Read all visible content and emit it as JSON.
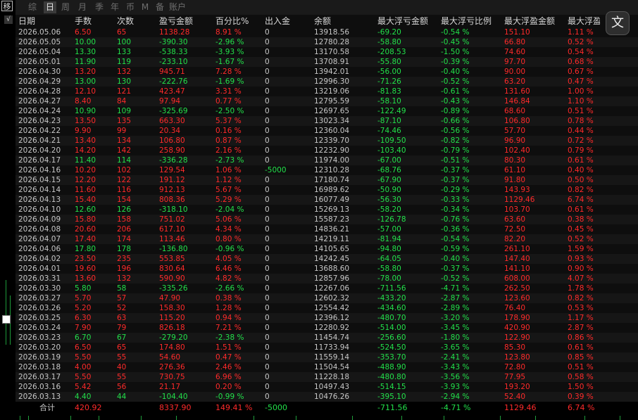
{
  "window": {
    "mode_icon_label": "移"
  },
  "tabs": [
    "综",
    "日",
    "周",
    "月",
    "季",
    "年",
    "币",
    "M",
    "备",
    "账户"
  ],
  "active_tab": 1,
  "headers": [
    "日期",
    "手数",
    "次数",
    "盈亏金额",
    "百分比%",
    "出入金",
    "余额",
    "最大浮亏金额",
    "最大浮亏比例",
    "最大浮盈金额",
    "最大浮盈比"
  ],
  "rows": [
    {
      "date": "2026.05.06",
      "lots": "6.50",
      "count": "65",
      "pnl": "1138.28",
      "pct": "8.91 %",
      "flow": "0",
      "balance": "13918.56",
      "dd_amt": "-69.20",
      "dd_pct": "-0.54 %",
      "fp_amt": "151.10",
      "fp_pct": "1.11 %",
      "sign": "up"
    },
    {
      "date": "2026.05.05",
      "lots": "10.00",
      "count": "100",
      "pnl": "-390.30",
      "pct": "-2.96 %",
      "flow": "0",
      "balance": "12780.28",
      "dd_amt": "-58.80",
      "dd_pct": "-0.45 %",
      "fp_amt": "66.80",
      "fp_pct": "0.52 %",
      "sign": "dn"
    },
    {
      "date": "2026.05.04",
      "lots": "13.30",
      "count": "133",
      "pnl": "-538.33",
      "pct": "-3.93 %",
      "flow": "0",
      "balance": "13170.58",
      "dd_amt": "-208.53",
      "dd_pct": "-1.50 %",
      "fp_amt": "74.60",
      "fp_pct": "0.54 %",
      "sign": "dn"
    },
    {
      "date": "2026.05.01",
      "lots": "11.90",
      "count": "119",
      "pnl": "-233.10",
      "pct": "-1.67 %",
      "flow": "0",
      "balance": "13708.91",
      "dd_amt": "-55.80",
      "dd_pct": "-0.39 %",
      "fp_amt": "97.70",
      "fp_pct": "0.68 %",
      "sign": "dn"
    },
    {
      "date": "2026.04.30",
      "lots": "13.20",
      "count": "132",
      "pnl": "945.71",
      "pct": "7.28 %",
      "flow": "0",
      "balance": "13942.01",
      "dd_amt": "-56.00",
      "dd_pct": "-0.40 %",
      "fp_amt": "90.00",
      "fp_pct": "0.67 %",
      "sign": "up"
    },
    {
      "date": "2026.04.29",
      "lots": "13.00",
      "count": "130",
      "pnl": "-222.76",
      "pct": "-1.69 %",
      "flow": "0",
      "balance": "12996.30",
      "dd_amt": "-71.26",
      "dd_pct": "-0.52 %",
      "fp_amt": "63.20",
      "fp_pct": "0.47 %",
      "sign": "dn"
    },
    {
      "date": "2026.04.28",
      "lots": "12.10",
      "count": "121",
      "pnl": "423.47",
      "pct": "3.31 %",
      "flow": "0",
      "balance": "13219.06",
      "dd_amt": "-81.83",
      "dd_pct": "-0.61 %",
      "fp_amt": "131.60",
      "fp_pct": "1.00 %",
      "sign": "up"
    },
    {
      "date": "2026.04.27",
      "lots": "8.40",
      "count": "84",
      "pnl": "97.94",
      "pct": "0.77 %",
      "flow": "0",
      "balance": "12795.59",
      "dd_amt": "-58.10",
      "dd_pct": "-0.43 %",
      "fp_amt": "146.84",
      "fp_pct": "1.10 %",
      "sign": "up"
    },
    {
      "date": "2026.04.24",
      "lots": "10.90",
      "count": "109",
      "pnl": "-325.69",
      "pct": "-2.50 %",
      "flow": "0",
      "balance": "12697.65",
      "dd_amt": "-122.49",
      "dd_pct": "-0.89 %",
      "fp_amt": "68.60",
      "fp_pct": "0.51 %",
      "sign": "dn"
    },
    {
      "date": "2026.04.23",
      "lots": "13.50",
      "count": "135",
      "pnl": "663.30",
      "pct": "5.37 %",
      "flow": "0",
      "balance": "13023.34",
      "dd_amt": "-87.10",
      "dd_pct": "-0.66 %",
      "fp_amt": "106.80",
      "fp_pct": "0.78 %",
      "sign": "up"
    },
    {
      "date": "2026.04.22",
      "lots": "9.90",
      "count": "99",
      "pnl": "20.34",
      "pct": "0.16 %",
      "flow": "0",
      "balance": "12360.04",
      "dd_amt": "-74.46",
      "dd_pct": "-0.56 %",
      "fp_amt": "57.70",
      "fp_pct": "0.44 %",
      "sign": "up"
    },
    {
      "date": "2026.04.21",
      "lots": "13.40",
      "count": "134",
      "pnl": "106.80",
      "pct": "0.87 %",
      "flow": "0",
      "balance": "12339.70",
      "dd_amt": "-109.50",
      "dd_pct": "-0.82 %",
      "fp_amt": "96.90",
      "fp_pct": "0.72 %",
      "sign": "up"
    },
    {
      "date": "2026.04.20",
      "lots": "14.20",
      "count": "142",
      "pnl": "258.90",
      "pct": "2.16 %",
      "flow": "0",
      "balance": "12232.90",
      "dd_amt": "-103.40",
      "dd_pct": "-0.79 %",
      "fp_amt": "102.40",
      "fp_pct": "0.79 %",
      "sign": "up"
    },
    {
      "date": "2026.04.17",
      "lots": "11.40",
      "count": "114",
      "pnl": "-336.28",
      "pct": "-2.73 %",
      "flow": "0",
      "balance": "11974.00",
      "dd_amt": "-67.00",
      "dd_pct": "-0.51 %",
      "fp_amt": "80.30",
      "fp_pct": "0.61 %",
      "sign": "dn"
    },
    {
      "date": "2026.04.16",
      "lots": "10.20",
      "count": "102",
      "pnl": "129.54",
      "pct": "1.06 %",
      "flow": "-5000",
      "balance": "12310.28",
      "dd_amt": "-68.76",
      "dd_pct": "-0.37 %",
      "fp_amt": "61.10",
      "fp_pct": "0.40 %",
      "sign": "up"
    },
    {
      "date": "2026.04.15",
      "lots": "12.20",
      "count": "122",
      "pnl": "191.12",
      "pct": "1.12 %",
      "flow": "0",
      "balance": "17180.74",
      "dd_amt": "-67.90",
      "dd_pct": "-0.37 %",
      "fp_amt": "91.80",
      "fp_pct": "0.50 %",
      "sign": "up"
    },
    {
      "date": "2026.04.14",
      "lots": "11.60",
      "count": "116",
      "pnl": "912.13",
      "pct": "5.67 %",
      "flow": "0",
      "balance": "16989.62",
      "dd_amt": "-50.90",
      "dd_pct": "-0.29 %",
      "fp_amt": "143.93",
      "fp_pct": "0.82 %",
      "sign": "up"
    },
    {
      "date": "2026.04.13",
      "lots": "15.40",
      "count": "154",
      "pnl": "808.36",
      "pct": "5.29 %",
      "flow": "0",
      "balance": "16077.49",
      "dd_amt": "-56.30",
      "dd_pct": "-0.33 %",
      "fp_amt": "1129.46",
      "fp_pct": "6.74 %",
      "sign": "up"
    },
    {
      "date": "2026.04.10",
      "lots": "12.60",
      "count": "126",
      "pnl": "-318.10",
      "pct": "-2.04 %",
      "flow": "0",
      "balance": "15269.13",
      "dd_amt": "-58.20",
      "dd_pct": "-0.34 %",
      "fp_amt": "103.70",
      "fp_pct": "0.61 %",
      "sign": "dn"
    },
    {
      "date": "2026.04.09",
      "lots": "15.80",
      "count": "158",
      "pnl": "751.02",
      "pct": "5.06 %",
      "flow": "0",
      "balance": "15587.23",
      "dd_amt": "-126.78",
      "dd_pct": "-0.76 %",
      "fp_amt": "63.60",
      "fp_pct": "0.38 %",
      "sign": "up"
    },
    {
      "date": "2026.04.08",
      "lots": "20.60",
      "count": "206",
      "pnl": "617.10",
      "pct": "4.34 %",
      "flow": "0",
      "balance": "14836.21",
      "dd_amt": "-57.00",
      "dd_pct": "-0.36 %",
      "fp_amt": "72.50",
      "fp_pct": "0.45 %",
      "sign": "up"
    },
    {
      "date": "2026.04.07",
      "lots": "17.40",
      "count": "174",
      "pnl": "113.46",
      "pct": "0.80 %",
      "flow": "0",
      "balance": "14219.11",
      "dd_amt": "-81.94",
      "dd_pct": "-0.54 %",
      "fp_amt": "82.20",
      "fp_pct": "0.52 %",
      "sign": "up"
    },
    {
      "date": "2026.04.06",
      "lots": "17.80",
      "count": "178",
      "pnl": "-136.80",
      "pct": "-0.96 %",
      "flow": "0",
      "balance": "14105.65",
      "dd_amt": "-94.80",
      "dd_pct": "-0.59 %",
      "fp_amt": "261.10",
      "fp_pct": "1.59 %",
      "sign": "dn"
    },
    {
      "date": "2026.04.02",
      "lots": "23.50",
      "count": "235",
      "pnl": "553.85",
      "pct": "4.05 %",
      "flow": "0",
      "balance": "14242.45",
      "dd_amt": "-64.05",
      "dd_pct": "-0.40 %",
      "fp_amt": "147.40",
      "fp_pct": "0.93 %",
      "sign": "up"
    },
    {
      "date": "2026.04.01",
      "lots": "19.60",
      "count": "196",
      "pnl": "830.64",
      "pct": "6.46 %",
      "flow": "0",
      "balance": "13688.60",
      "dd_amt": "-58.80",
      "dd_pct": "-0.37 %",
      "fp_amt": "141.10",
      "fp_pct": "0.90 %",
      "sign": "up"
    },
    {
      "date": "2026.03.31",
      "lots": "13.60",
      "count": "132",
      "pnl": "590.90",
      "pct": "4.82 %",
      "flow": "0",
      "balance": "12857.96",
      "dd_amt": "-78.00",
      "dd_pct": "-0.52 %",
      "fp_amt": "608.00",
      "fp_pct": "4.07 %",
      "sign": "up"
    },
    {
      "date": "2026.03.30",
      "lots": "5.80",
      "count": "58",
      "pnl": "-335.26",
      "pct": "-2.66 %",
      "flow": "0",
      "balance": "12267.06",
      "dd_amt": "-711.56",
      "dd_pct": "-4.71 %",
      "fp_amt": "262.50",
      "fp_pct": "1.78 %",
      "sign": "dn"
    },
    {
      "date": "2026.03.27",
      "lots": "5.70",
      "count": "57",
      "pnl": "47.90",
      "pct": "0.38 %",
      "flow": "0",
      "balance": "12602.32",
      "dd_amt": "-433.20",
      "dd_pct": "-2.87 %",
      "fp_amt": "123.60",
      "fp_pct": "0.82 %",
      "sign": "up"
    },
    {
      "date": "2026.03.26",
      "lots": "5.20",
      "count": "52",
      "pnl": "158.30",
      "pct": "1.28 %",
      "flow": "0",
      "balance": "12554.42",
      "dd_amt": "-434.60",
      "dd_pct": "-2.89 %",
      "fp_amt": "76.40",
      "fp_pct": "0.53 %",
      "sign": "up"
    },
    {
      "date": "2026.03.25",
      "lots": "6.30",
      "count": "63",
      "pnl": "115.20",
      "pct": "0.94 %",
      "flow": "0",
      "balance": "12396.12",
      "dd_amt": "-480.70",
      "dd_pct": "-3.20 %",
      "fp_amt": "178.90",
      "fp_pct": "1.17 %",
      "sign": "up"
    },
    {
      "date": "2026.03.24",
      "lots": "7.90",
      "count": "79",
      "pnl": "826.18",
      "pct": "7.21 %",
      "flow": "0",
      "balance": "12280.92",
      "dd_amt": "-514.00",
      "dd_pct": "-3.45 %",
      "fp_amt": "420.90",
      "fp_pct": "2.87 %",
      "sign": "up"
    },
    {
      "date": "2026.03.23",
      "lots": "6.70",
      "count": "67",
      "pnl": "-279.20",
      "pct": "-2.38 %",
      "flow": "0",
      "balance": "11454.74",
      "dd_amt": "-256.60",
      "dd_pct": "-1.80 %",
      "fp_amt": "122.90",
      "fp_pct": "0.86 %",
      "sign": "dn"
    },
    {
      "date": "2026.03.20",
      "lots": "6.50",
      "count": "65",
      "pnl": "174.80",
      "pct": "1.51 %",
      "flow": "0",
      "balance": "11733.94",
      "dd_amt": "-524.50",
      "dd_pct": "-3.65 %",
      "fp_amt": "85.30",
      "fp_pct": "0.61 %",
      "sign": "up"
    },
    {
      "date": "2026.03.19",
      "lots": "5.50",
      "count": "55",
      "pnl": "54.60",
      "pct": "0.47 %",
      "flow": "0",
      "balance": "11559.14",
      "dd_amt": "-353.70",
      "dd_pct": "-2.41 %",
      "fp_amt": "123.80",
      "fp_pct": "0.85 %",
      "sign": "up"
    },
    {
      "date": "2026.03.18",
      "lots": "4.00",
      "count": "40",
      "pnl": "276.36",
      "pct": "2.46 %",
      "flow": "0",
      "balance": "11504.54",
      "dd_amt": "-488.90",
      "dd_pct": "-3.43 %",
      "fp_amt": "72.80",
      "fp_pct": "0.51 %",
      "sign": "up"
    },
    {
      "date": "2026.03.17",
      "lots": "5.50",
      "count": "55",
      "pnl": "730.75",
      "pct": "6.96 %",
      "flow": "0",
      "balance": "11228.18",
      "dd_amt": "-480.80",
      "dd_pct": "-3.56 %",
      "fp_amt": "77.95",
      "fp_pct": "0.58 %",
      "sign": "up"
    },
    {
      "date": "2026.03.16",
      "lots": "5.42",
      "count": "56",
      "pnl": "21.17",
      "pct": "0.20 %",
      "flow": "0",
      "balance": "10497.43",
      "dd_amt": "-514.15",
      "dd_pct": "-3.93 %",
      "fp_amt": "193.20",
      "fp_pct": "1.50 %",
      "sign": "up"
    },
    {
      "date": "2026.03.13",
      "lots": "4.40",
      "count": "44",
      "pnl": "-104.40",
      "pct": "-0.99 %",
      "flow": "0",
      "balance": "10476.26",
      "dd_amt": "-395.10",
      "dd_pct": "-2.94 %",
      "fp_amt": "52.40",
      "fp_pct": "0.39 %",
      "sign": "dn"
    }
  ],
  "total": {
    "label": "合计",
    "lots": "420.92",
    "pnl": "8337.90",
    "pct": "149.41 %",
    "flow": "-5000",
    "dd_amt": "-711.56",
    "dd_pct": "-4.71 %",
    "fp_amt": "1129.46",
    "fp_pct": "6.74 %"
  },
  "translate_button": "文",
  "colors": {
    "up": "#ff2a2a",
    "down": "#22e04a",
    "background": "#0e0e0e"
  }
}
